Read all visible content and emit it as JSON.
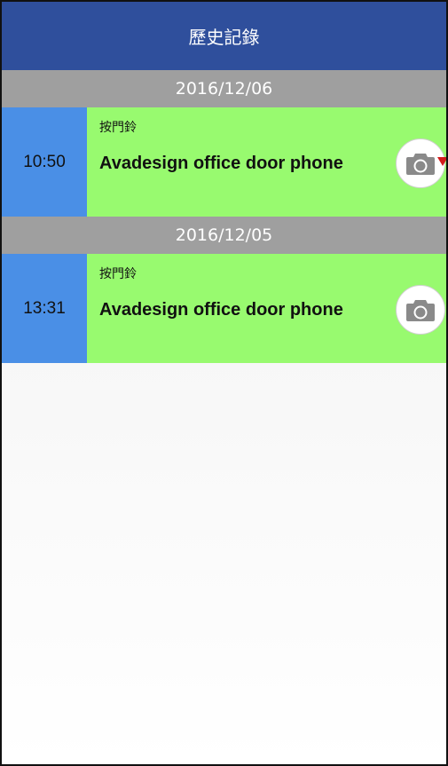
{
  "header": {
    "title": "歷史記錄"
  },
  "groups": [
    {
      "date": "2016/12/06",
      "records": [
        {
          "time": "10:50",
          "event": "按門鈴",
          "device": "Avadesign office door phone",
          "unread": true
        }
      ]
    },
    {
      "date": "2016/12/05",
      "records": [
        {
          "time": "13:31",
          "event": "按門鈴",
          "device": "Avadesign office door phone",
          "unread": false
        }
      ]
    }
  ],
  "icons": {
    "snapshot": "camera-icon",
    "unread": "red-triangle-icon"
  },
  "colors": {
    "header": "#2f4f9c",
    "date_bar": "#9f9f9f",
    "time_cell": "#4a8fe6",
    "record_bg": "#98fa6f",
    "unread": "#d11a1a"
  }
}
